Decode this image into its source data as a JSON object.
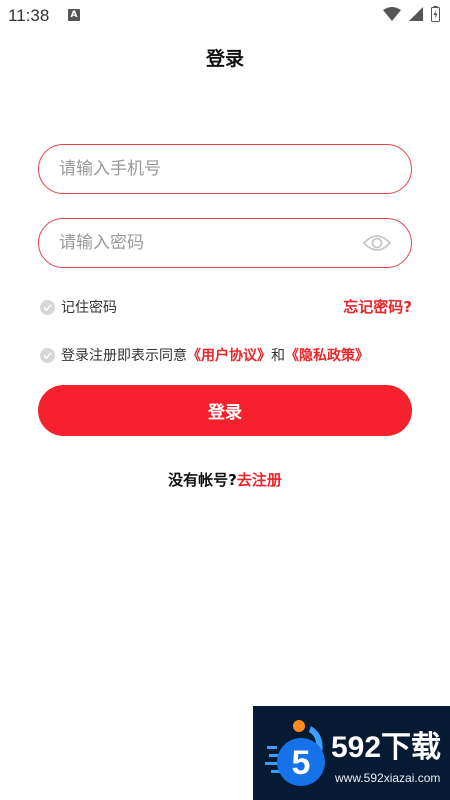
{
  "status_bar": {
    "time": "11:38",
    "notification_letter": "A"
  },
  "header": {
    "title": "登录"
  },
  "form": {
    "phone_placeholder": "请输入手机号",
    "phone_value": "",
    "password_placeholder": "请输入密码",
    "password_value": "",
    "remember_label": "记住密码",
    "forgot_label": "忘记密码?",
    "agreement_prefix": "登录注册即表示同意",
    "user_agreement": "《用户协议》",
    "agreement_and": "和",
    "privacy_policy": "《隐私政策》",
    "login_label": "登录"
  },
  "register": {
    "question": "没有帐号?",
    "link": "去注册"
  },
  "watermark": {
    "title": "592下载",
    "url": "www.592xiazai.com",
    "logo_digit": "5"
  },
  "colors": {
    "accent": "#f5222d",
    "link": "#e8272d",
    "watermark_bg": "#061a33"
  }
}
